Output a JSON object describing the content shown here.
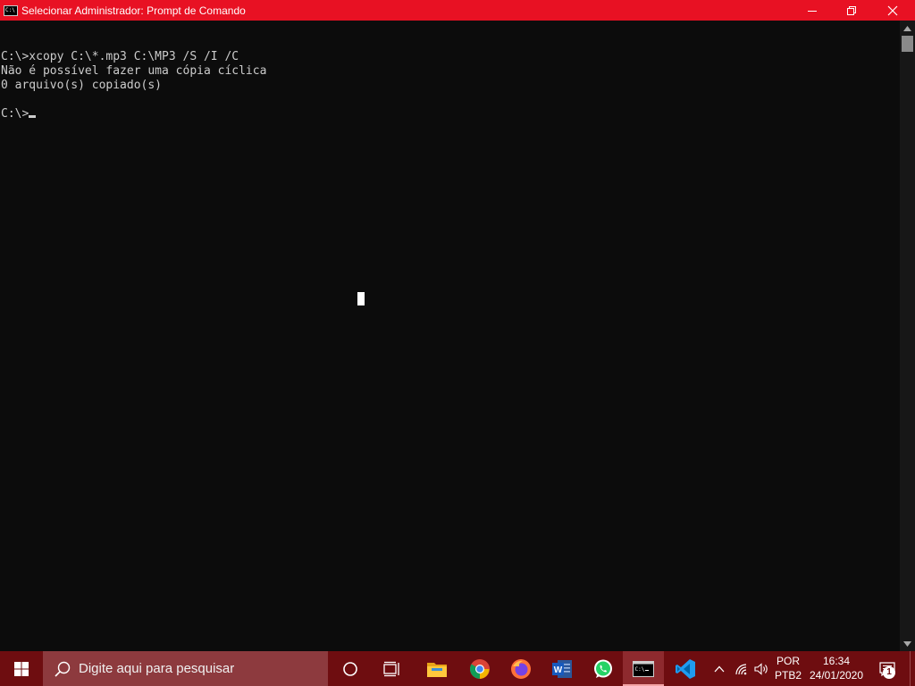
{
  "window": {
    "title": "Selecionar Administrador: Prompt de Comando",
    "icon_text": "C:\\",
    "icon": "cmd-icon",
    "accent": "#e81123"
  },
  "console": {
    "lines": [
      "",
      "C:\\>xcopy C:\\*.mp3 C:\\MP3 /S /I /C",
      "Não é possível fazer uma cópia cíclica",
      "0 arquivo(s) copiado(s)",
      "",
      "C:\\>"
    ],
    "text_color": "#cccccc",
    "background": "#0c0c0c"
  },
  "taskbar": {
    "search_placeholder": "Digite aqui para pesquisar",
    "apps": [
      {
        "name": "cortana",
        "icon": "cortana-circle-icon"
      },
      {
        "name": "task-view",
        "icon": "task-view-icon"
      },
      {
        "name": "file-explorer",
        "icon": "folder-icon"
      },
      {
        "name": "chrome",
        "icon": "chrome-icon"
      },
      {
        "name": "firefox",
        "icon": "firefox-icon"
      },
      {
        "name": "word",
        "icon": "word-icon"
      },
      {
        "name": "whatsapp",
        "icon": "whatsapp-icon"
      },
      {
        "name": "command-prompt",
        "icon": "cmd-icon",
        "active": true
      },
      {
        "name": "vscode",
        "icon": "vscode-icon"
      }
    ],
    "language": {
      "line1": "POR",
      "line2": "PTB2"
    },
    "clock": {
      "time": "16:34",
      "date": "24/01/2020"
    },
    "notification_count": "1",
    "color": "#6e0d10"
  }
}
